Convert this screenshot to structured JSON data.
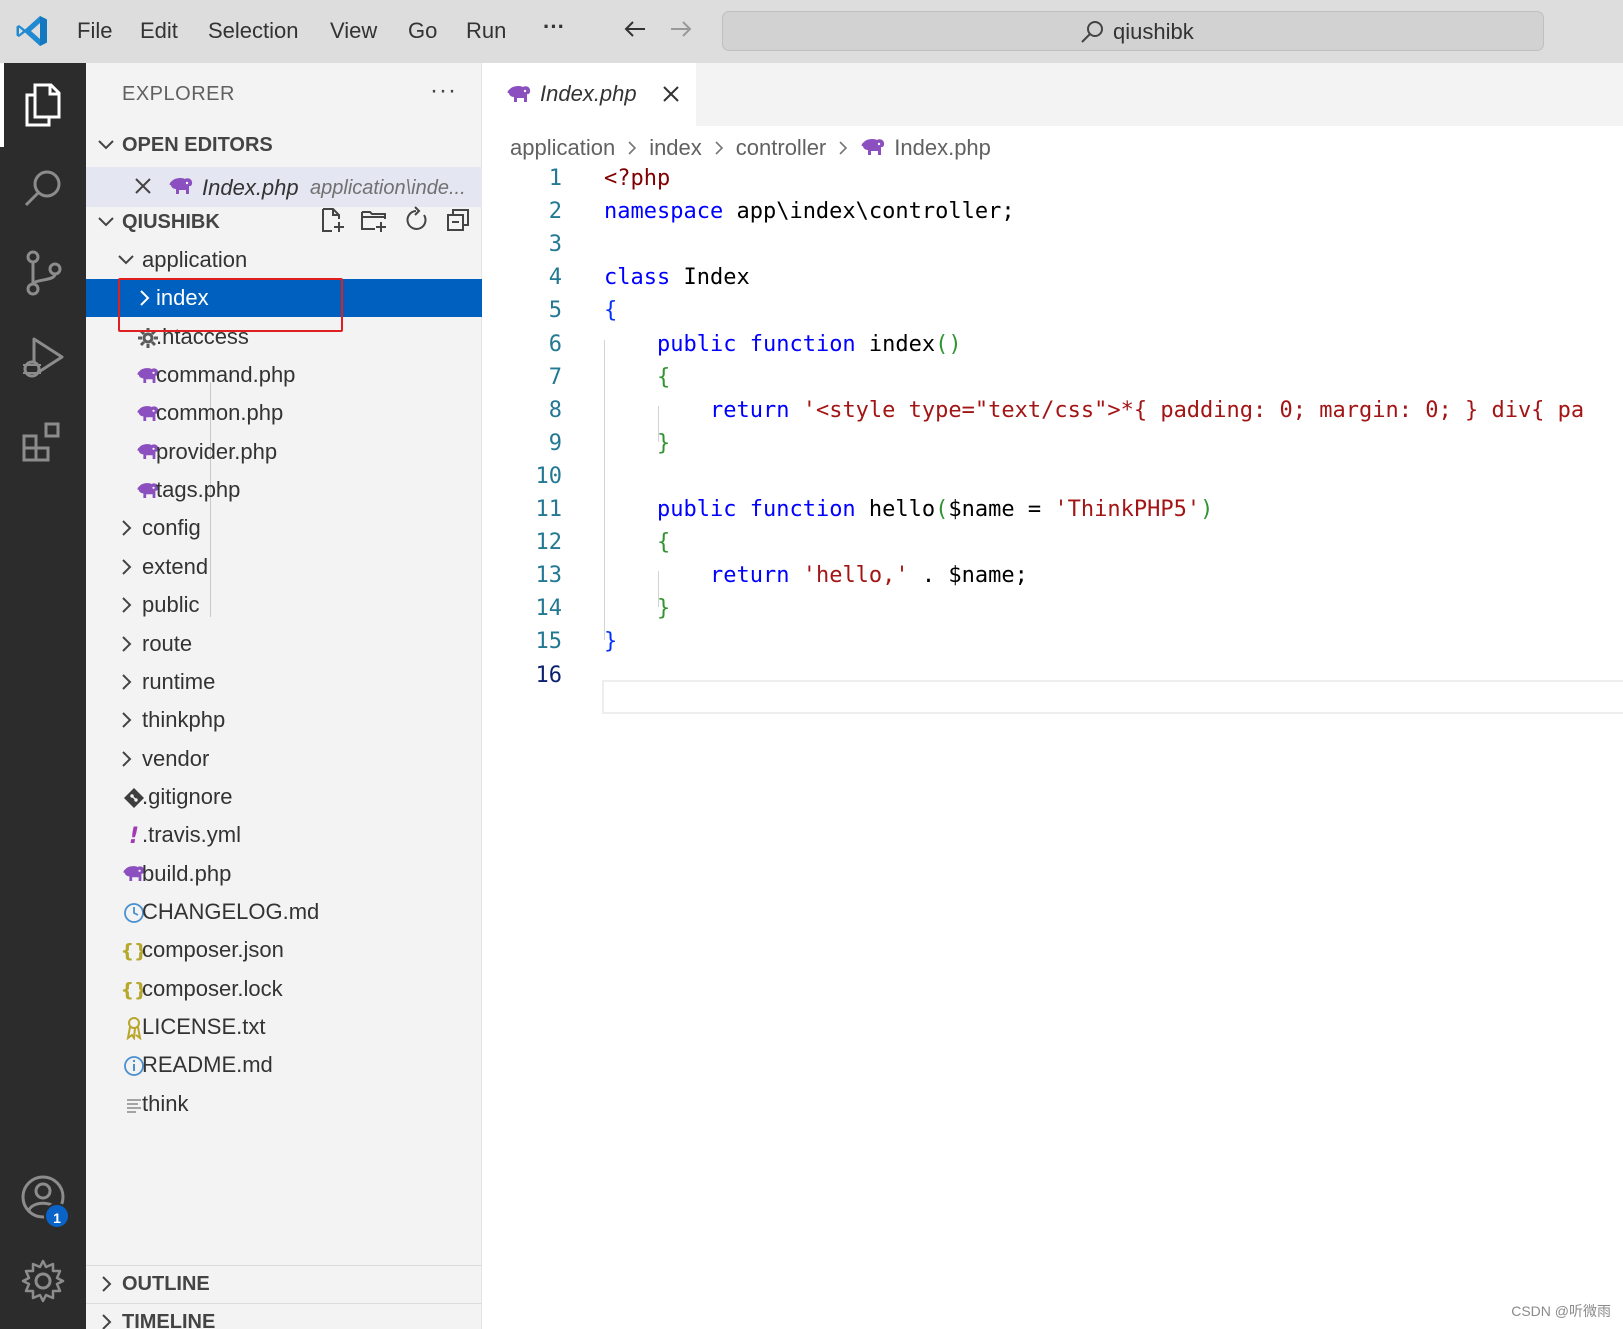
{
  "titlebar": {
    "menu": [
      "File",
      "Edit",
      "Selection",
      "View",
      "Go",
      "Run",
      "···"
    ],
    "search_text": "qiushibk"
  },
  "activity_bar": {
    "items": [
      "explorer-icon",
      "search-icon",
      "source-control-icon",
      "run-debug-icon",
      "extensions-icon"
    ],
    "account_badge": "1"
  },
  "sidebar": {
    "title": "EXPLORER",
    "more": "···",
    "open_editors": {
      "label": "OPEN EDITORS",
      "items": [
        {
          "name": "Index.php",
          "path": "application\\inde..."
        }
      ]
    },
    "workspace": {
      "label": "QIUSHIBK",
      "tree": [
        {
          "label": "application",
          "type": "folder-open",
          "icon": "chevron-down-icon"
        },
        {
          "label": "index",
          "type": "folder",
          "icon": "chevron-right-icon",
          "selected": true
        },
        {
          "label": ".htaccess",
          "type": "file",
          "icon": "gear-icon"
        },
        {
          "label": "command.php",
          "type": "file",
          "icon": "php-elephant-icon"
        },
        {
          "label": "common.php",
          "type": "file",
          "icon": "php-elephant-icon"
        },
        {
          "label": "provider.php",
          "type": "file",
          "icon": "php-elephant-icon"
        },
        {
          "label": "tags.php",
          "type": "file",
          "icon": "php-elephant-icon"
        },
        {
          "label": "config",
          "type": "folder",
          "icon": "chevron-right-icon"
        },
        {
          "label": "extend",
          "type": "folder",
          "icon": "chevron-right-icon"
        },
        {
          "label": "public",
          "type": "folder",
          "icon": "chevron-right-icon"
        },
        {
          "label": "route",
          "type": "folder",
          "icon": "chevron-right-icon"
        },
        {
          "label": "runtime",
          "type": "folder",
          "icon": "chevron-right-icon"
        },
        {
          "label": "thinkphp",
          "type": "folder",
          "icon": "chevron-right-icon"
        },
        {
          "label": "vendor",
          "type": "folder",
          "icon": "chevron-right-icon"
        },
        {
          "label": ".gitignore",
          "type": "file",
          "icon": "git-icon"
        },
        {
          "label": ".travis.yml",
          "type": "file",
          "icon": "yaml-exclamation-icon"
        },
        {
          "label": "build.php",
          "type": "file",
          "icon": "php-elephant-icon"
        },
        {
          "label": "CHANGELOG.md",
          "type": "file",
          "icon": "clock-icon"
        },
        {
          "label": "composer.json",
          "type": "file",
          "icon": "json-braces-icon"
        },
        {
          "label": "composer.lock",
          "type": "file",
          "icon": "json-braces-icon"
        },
        {
          "label": "LICENSE.txt",
          "type": "file",
          "icon": "license-icon"
        },
        {
          "label": "README.md",
          "type": "file",
          "icon": "info-icon"
        },
        {
          "label": "think",
          "type": "file",
          "icon": "text-lines-icon"
        }
      ]
    },
    "outline_label": "OUTLINE",
    "timeline_label": "TIMELINE"
  },
  "editor": {
    "tab_label": "Index.php",
    "breadcrumb": [
      "application",
      "index",
      "controller",
      "Index.php"
    ],
    "current_line": 16,
    "lines": [
      [
        [
          "tok-tag",
          "<?php"
        ]
      ],
      [
        [
          "tok-kw",
          "namespace"
        ],
        [
          "tok-pl",
          " app\\index\\controller;"
        ]
      ],
      [],
      [
        [
          "tok-kw",
          "class"
        ],
        [
          "tok-pl",
          " Index"
        ]
      ],
      [
        [
          "tok-b1",
          "{"
        ]
      ],
      [
        [
          "tok-pl",
          "    "
        ],
        [
          "tok-kw",
          "public"
        ],
        [
          "tok-pl",
          " "
        ],
        [
          "tok-kw",
          "function"
        ],
        [
          "tok-pl",
          " index"
        ],
        [
          "tok-b2",
          "()"
        ]
      ],
      [
        [
          "tok-pl",
          "    "
        ],
        [
          "tok-b2",
          "{"
        ]
      ],
      [
        [
          "tok-pl",
          "        "
        ],
        [
          "tok-kw",
          "return"
        ],
        [
          "tok-pl",
          " "
        ],
        [
          "tok-str",
          "'<style type=\"text/css\">*{ padding: 0; margin: 0; } div{ pa"
        ]
      ],
      [
        [
          "tok-pl",
          "    "
        ],
        [
          "tok-b2",
          "}"
        ]
      ],
      [],
      [
        [
          "tok-pl",
          "    "
        ],
        [
          "tok-kw",
          "public"
        ],
        [
          "tok-pl",
          " "
        ],
        [
          "tok-kw",
          "function"
        ],
        [
          "tok-pl",
          " hello"
        ],
        [
          "tok-b2",
          "("
        ],
        [
          "tok-pl",
          "$name = "
        ],
        [
          "tok-str",
          "'ThinkPHP5'"
        ],
        [
          "tok-b2",
          ")"
        ]
      ],
      [
        [
          "tok-pl",
          "    "
        ],
        [
          "tok-b2",
          "{"
        ]
      ],
      [
        [
          "tok-pl",
          "        "
        ],
        [
          "tok-kw",
          "return"
        ],
        [
          "tok-pl",
          " "
        ],
        [
          "tok-str",
          "'hello,'"
        ],
        [
          "tok-pl",
          " . $name;"
        ]
      ],
      [
        [
          "tok-pl",
          "    "
        ],
        [
          "tok-b2",
          "}"
        ]
      ],
      [
        [
          "tok-b1",
          "}"
        ]
      ],
      []
    ]
  },
  "watermark": "CSDN @听微雨",
  "colors": {
    "selection": "#0060c0",
    "activity_bar": "#2c2c2c",
    "sidebar": "#f3f3f3",
    "keyword": "#0000ff",
    "string": "#a31515",
    "php_icon": "#8b4fbf",
    "highlight_box": "#e02020"
  }
}
